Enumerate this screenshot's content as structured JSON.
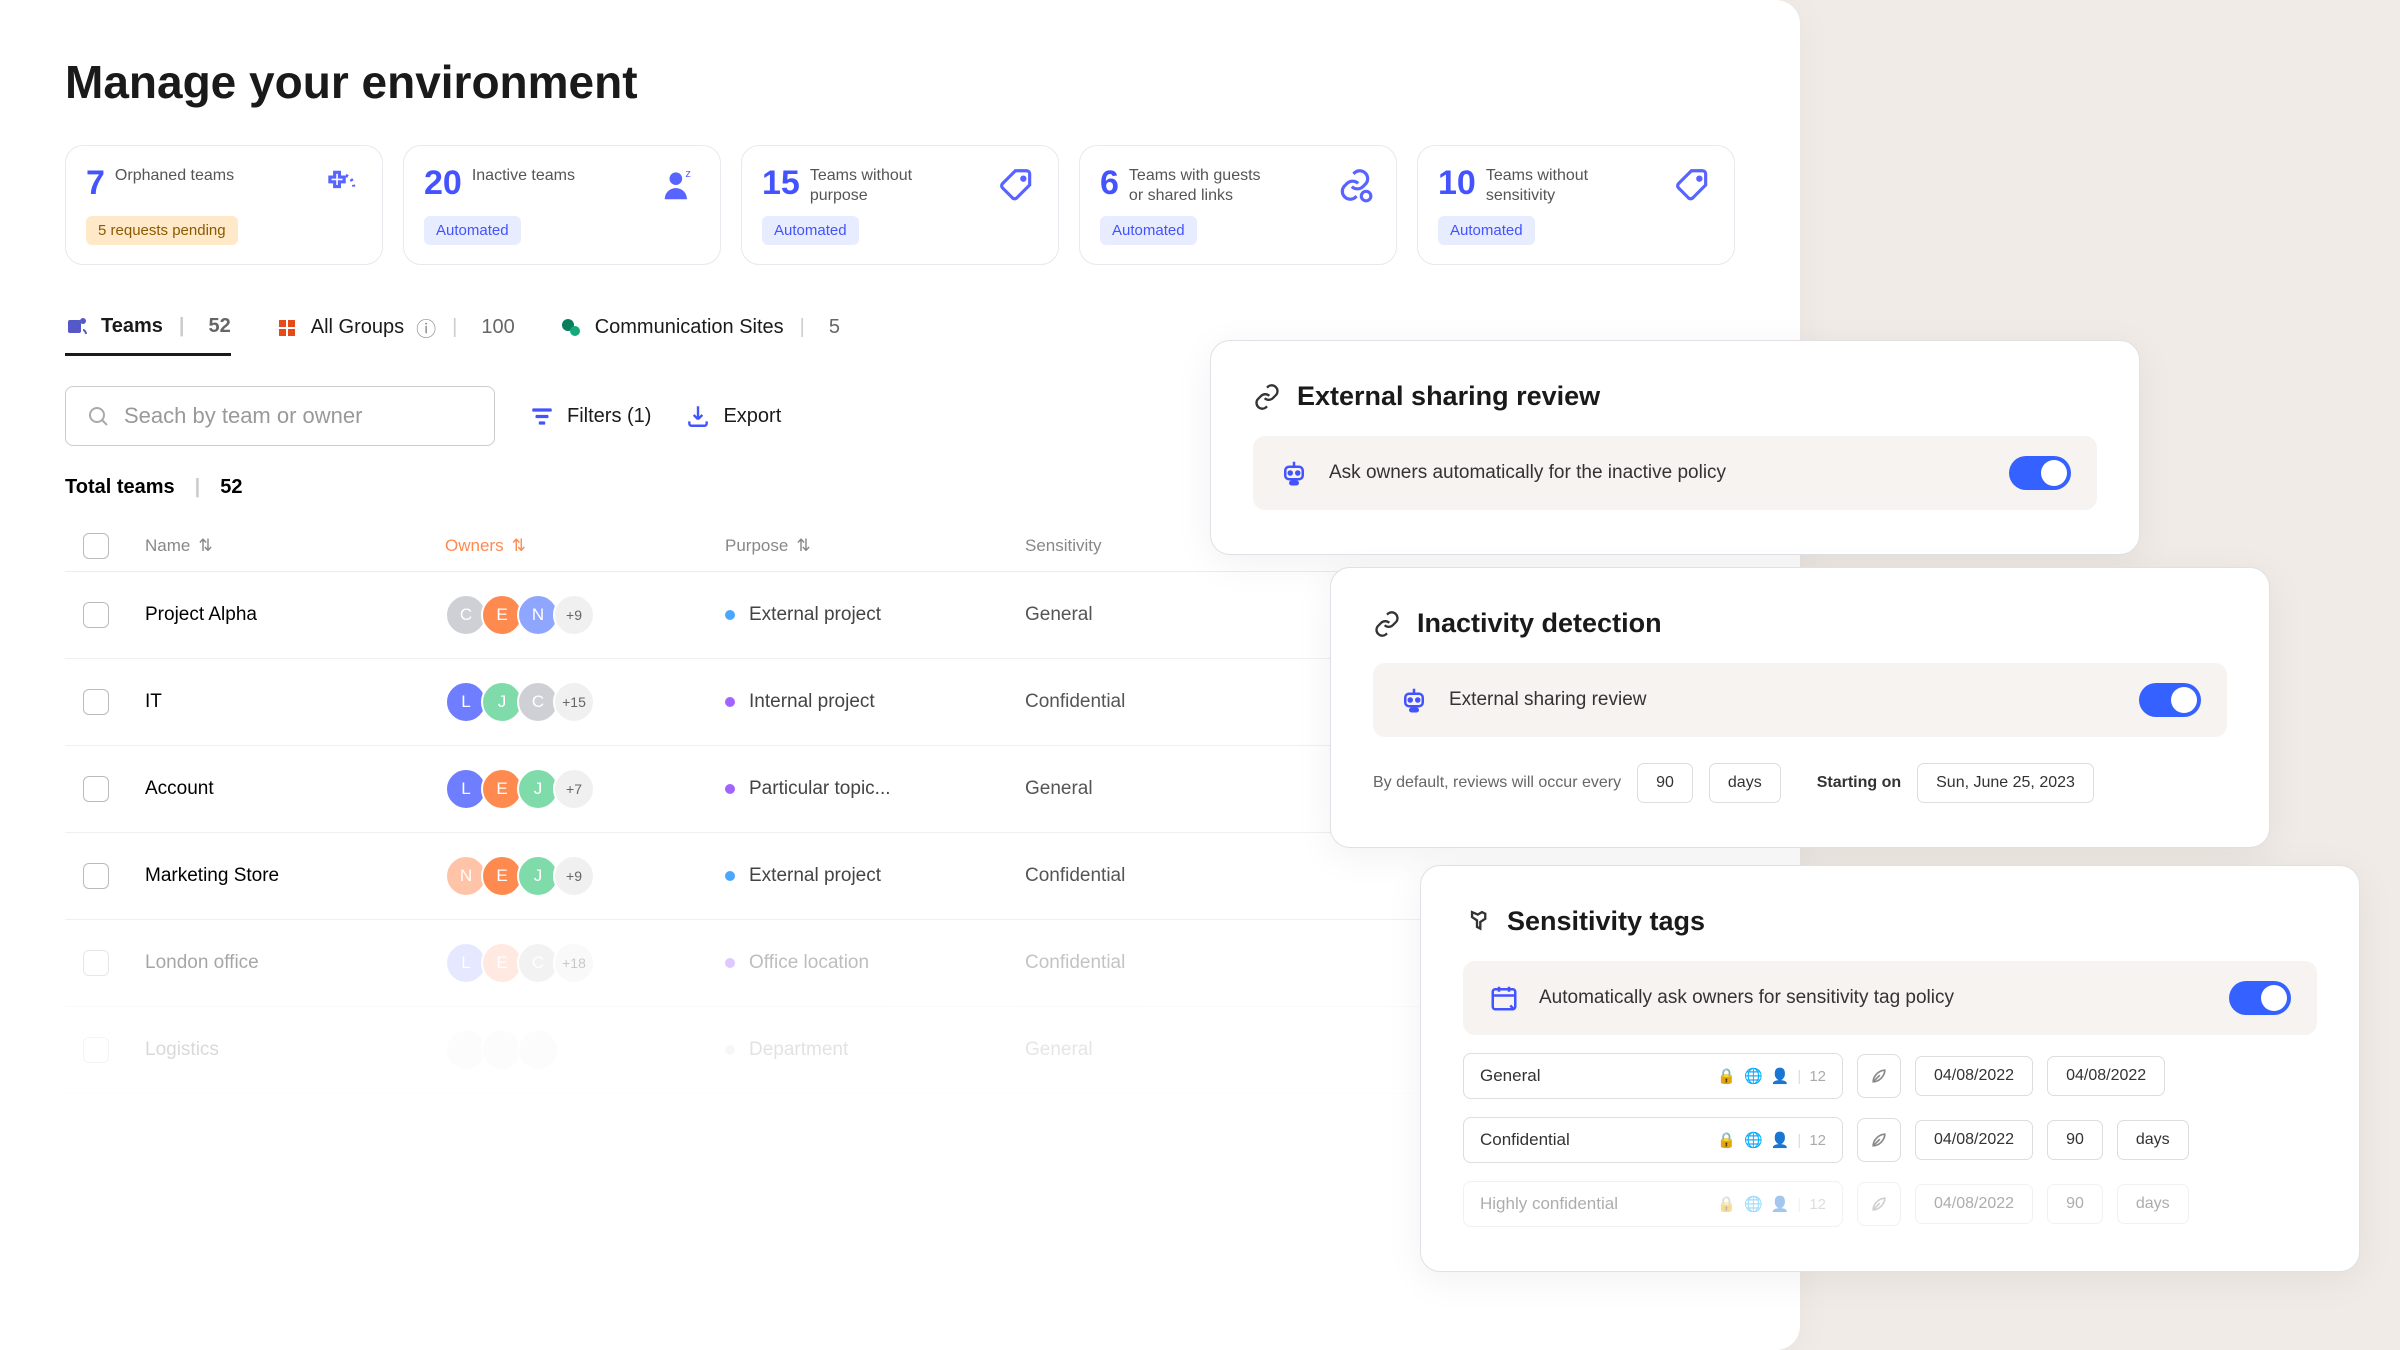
{
  "page": {
    "title": "Manage your environment"
  },
  "stats": [
    {
      "number": "7",
      "label": "Orphaned teams",
      "badge": "5 requests pending",
      "badgeType": "pending",
      "icon": "plus-dotted"
    },
    {
      "number": "20",
      "label": "Inactive teams",
      "badge": "Automated",
      "badgeType": "auto",
      "icon": "person-sleep"
    },
    {
      "number": "15",
      "label": "Teams without purpose",
      "badge": "Automated",
      "badgeType": "auto",
      "icon": "tag-question"
    },
    {
      "number": "6",
      "label": "Teams with guests or shared links",
      "badge": "Automated",
      "badgeType": "auto",
      "icon": "link-guest"
    },
    {
      "number": "10",
      "label": "Teams without sensitivity",
      "badge": "Automated",
      "badgeType": "auto",
      "icon": "tag-shield"
    }
  ],
  "tabs": [
    {
      "label": "Teams",
      "count": "52",
      "active": true,
      "icon": "teams"
    },
    {
      "label": "All Groups",
      "count": "100",
      "active": false,
      "icon": "office"
    },
    {
      "label": "Communication Sites",
      "count": "5",
      "active": false,
      "icon": "sharepoint"
    }
  ],
  "search": {
    "placeholder": "Seach by team or owner"
  },
  "toolbar": {
    "filters_label": "Filters (1)",
    "export_label": "Export"
  },
  "totals": {
    "label": "Total teams",
    "count": "52"
  },
  "columns": {
    "name": "Name",
    "owners": "Owners",
    "purpose": "Purpose",
    "sensitivity": "Sensitivity"
  },
  "rows": [
    {
      "name": "Project Alpha",
      "avatars": [
        {
          "l": "C",
          "c": "#cfcfd6"
        },
        {
          "l": "E",
          "c": "#ff8a50"
        },
        {
          "l": "N",
          "c": "#8fa6ff"
        }
      ],
      "more": "+9",
      "purpose": "External project",
      "dot": "#4aa7ff",
      "sensitivity": "General"
    },
    {
      "name": "IT",
      "avatars": [
        {
          "l": "L",
          "c": "#6f7dff"
        },
        {
          "l": "J",
          "c": "#7fdcaa"
        },
        {
          "l": "C",
          "c": "#cfcfd6"
        }
      ],
      "more": "+15",
      "purpose": "Internal project",
      "dot": "#a065ff",
      "sensitivity": "Confidential"
    },
    {
      "name": "Account",
      "avatars": [
        {
          "l": "L",
          "c": "#6f7dff"
        },
        {
          "l": "E",
          "c": "#ff8a50"
        },
        {
          "l": "J",
          "c": "#7fdcaa"
        }
      ],
      "more": "+7",
      "purpose": "Particular topic...",
      "dot": "#a065ff",
      "sensitivity": "General"
    },
    {
      "name": "Marketing Store",
      "avatars": [
        {
          "l": "N",
          "c": "#ffc4a8"
        },
        {
          "l": "E",
          "c": "#ff8a50"
        },
        {
          "l": "J",
          "c": "#7fdcaa"
        }
      ],
      "more": "+9",
      "purpose": "External project",
      "dot": "#4aa7ff",
      "sensitivity": "Confidential"
    },
    {
      "name": "London office",
      "avatars": [
        {
          "l": "L",
          "c": "#b8c0ff"
        },
        {
          "l": "E",
          "c": "#ffc2a8"
        },
        {
          "l": "C",
          "c": "#dcdcdc"
        }
      ],
      "more": "+18",
      "purpose": "Office location",
      "dot": "#a065ff",
      "sensitivity": "Confidential",
      "fade": 1
    },
    {
      "name": "Logistics",
      "avatars": [
        {
          "l": "",
          "c": "#eee"
        },
        {
          "l": "",
          "c": "#eee"
        },
        {
          "l": "",
          "c": "#eee"
        }
      ],
      "more": "",
      "purpose": "Department",
      "dot": "#ccc",
      "sensitivity": "General",
      "fade": 2
    }
  ],
  "panels": {
    "external": {
      "title": "External sharing review",
      "policy_text": "Ask owners automatically for the inactive policy"
    },
    "inactivity": {
      "title": "Inactivity detection",
      "policy_text": "External sharing review",
      "interval_prefix": "By default, reviews will occur every",
      "interval_value": "90",
      "interval_unit": "days",
      "starting_label": "Starting on",
      "starting_value": "Sun, June 25, 2023"
    },
    "sensitivity": {
      "title": "Sensitivity tags",
      "policy_text": "Automatically ask owners for sensitivity tag policy",
      "tags": [
        {
          "name": "General",
          "count": "12",
          "date1": "04/08/2022",
          "date2": "04/08/2022",
          "unit": ""
        },
        {
          "name": "Confidential",
          "count": "12",
          "date1": "04/08/2022",
          "num": "90",
          "unit": "days"
        },
        {
          "name": "Highly confidential",
          "count": "12",
          "date1": "04/08/2022",
          "num": "90",
          "unit": "days",
          "fade": true
        }
      ]
    }
  }
}
